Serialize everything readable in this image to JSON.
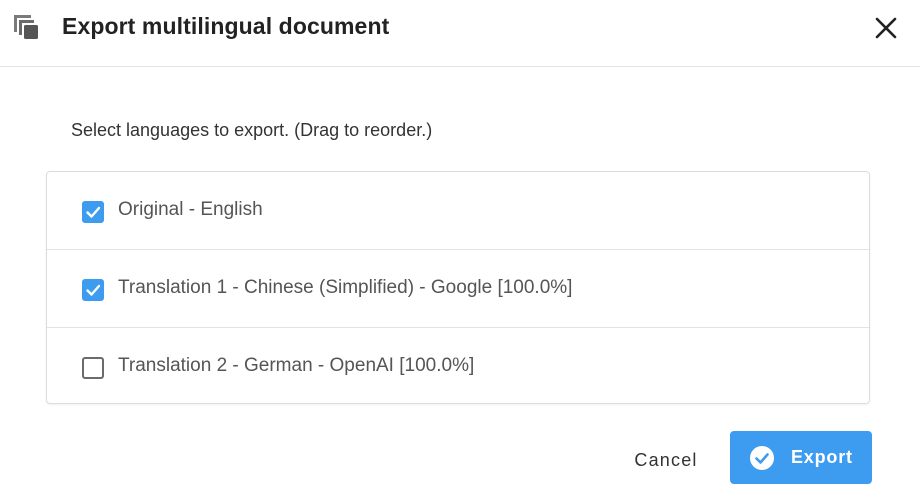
{
  "dialog": {
    "title": "Export multilingual document",
    "title_icon": "copy-stack-icon",
    "close_icon": "close-icon"
  },
  "main": {
    "instructions": "Select languages to export. (Drag to reorder.)",
    "languages": [
      {
        "label": "Original - English",
        "checked": true
      },
      {
        "label": "Translation 1 - Chinese (Simplified) - Google [100.0%]",
        "checked": true
      },
      {
        "label": "Translation 2 - German - OpenAI [100.0%]",
        "checked": false
      }
    ]
  },
  "footer": {
    "cancel_label": "Cancel",
    "export_label": "Export",
    "export_icon": "check-circle-icon"
  },
  "colors": {
    "accent": "#3d9bf0",
    "divider": "#e3e3e3"
  }
}
